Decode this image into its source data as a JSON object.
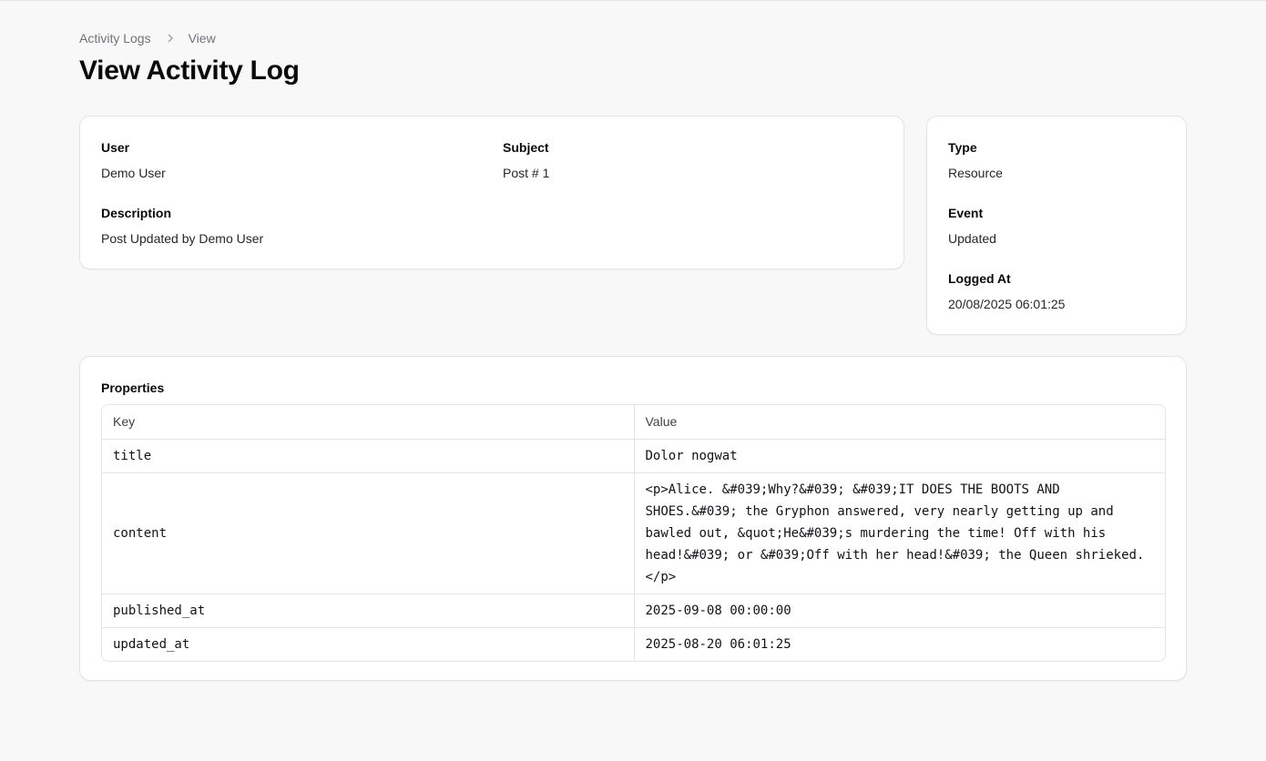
{
  "breadcrumb": {
    "items": [
      "Activity Logs",
      "View"
    ]
  },
  "page": {
    "title": "View Activity Log"
  },
  "main_card": {
    "user": {
      "label": "User",
      "value": "Demo User"
    },
    "subject": {
      "label": "Subject",
      "value": "Post # 1"
    },
    "description": {
      "label": "Description",
      "value": "Post Updated by Demo User"
    }
  },
  "side_card": {
    "type": {
      "label": "Type",
      "value": "Resource"
    },
    "event": {
      "label": "Event",
      "value": "Updated"
    },
    "logged_at": {
      "label": "Logged At",
      "value": "20/08/2025 06:01:25"
    }
  },
  "properties": {
    "label": "Properties",
    "columns": [
      "Key",
      "Value"
    ],
    "rows": [
      {
        "key": "title",
        "value": "Dolor nogwat"
      },
      {
        "key": "content",
        "value": "<p>Alice. &#039;Why?&#039; &#039;IT DOES THE BOOTS AND SHOES.&#039; the Gryphon answered, very nearly getting up and bawled out, &quot;He&#039;s murdering the time! Off with his head!&#039; or &#039;Off with her head!&#039; the Queen shrieked.</p>"
      },
      {
        "key": "published_at",
        "value": "2025-09-08 00:00:00"
      },
      {
        "key": "updated_at",
        "value": "2025-08-20 06:01:25"
      }
    ]
  },
  "icons": {
    "breadcrumb_separator": "chevron-right-icon"
  },
  "colors": {
    "background": "#f8f8f9",
    "card": "#ffffff",
    "border": "#e4e4e7",
    "muted_text": "#71717a"
  }
}
